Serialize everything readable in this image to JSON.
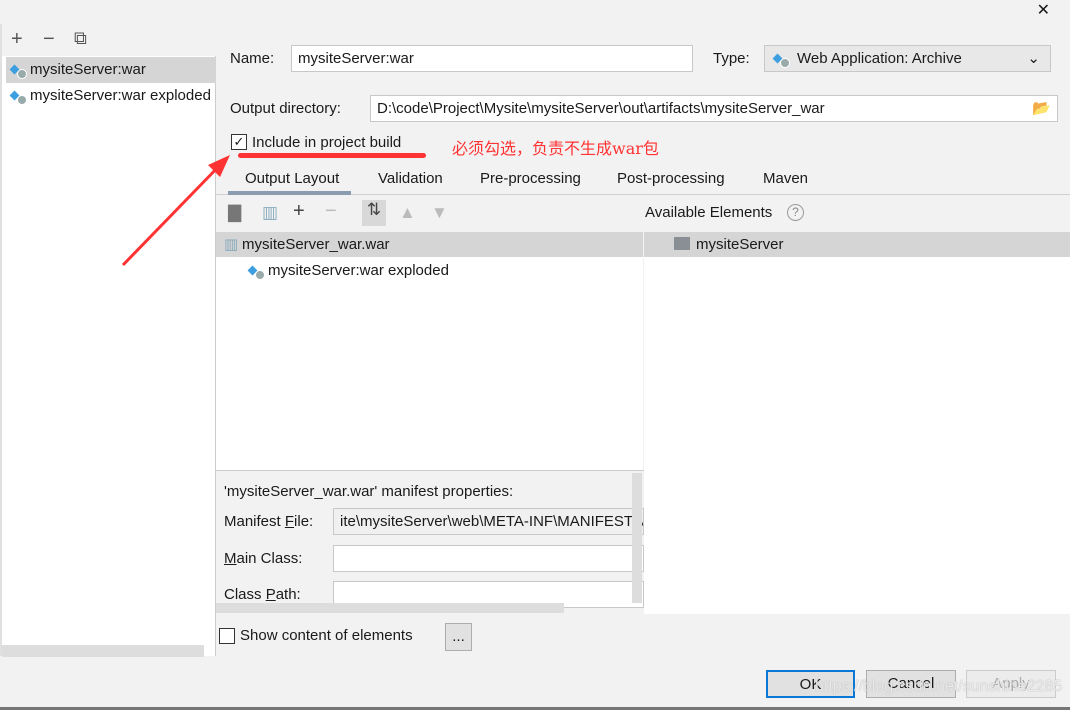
{
  "sidebar": {
    "toolbar": {
      "add": "+",
      "remove": "−",
      "copy": "⧉"
    },
    "items": [
      {
        "label": "mysiteServer:war",
        "selected": true
      },
      {
        "label": "mysiteServer:war exploded"
      }
    ]
  },
  "form": {
    "name_label": "Name:",
    "name_value": "mysiteServer:war",
    "type_label": "Type:",
    "type_value": "Web Application: Archive",
    "output_label": "Output directory:",
    "output_value": "D:\\code\\Project\\Mysite\\mysiteServer\\out\\artifacts\\mysiteServer_war",
    "include_label": "Include in project build",
    "include_checked": true
  },
  "annotation": {
    "text": "必须勾选，负责不生成war包",
    "color": "#ff3333"
  },
  "tabs": [
    "Output Layout",
    "Validation",
    "Pre-processing",
    "Post-processing",
    "Maven"
  ],
  "layout": {
    "tree": [
      {
        "label": "mysiteServer_war.war"
      },
      {
        "label": "mysiteServer:war exploded"
      }
    ],
    "available_title": "Available Elements",
    "available": [
      {
        "label": "mysiteServer"
      }
    ]
  },
  "manifest": {
    "title": "'mysiteServer_war.war' manifest properties:",
    "file_label": "Manifest File:",
    "file_value": "ite\\mysiteServer\\web\\META-INF\\MANIFEST.MF",
    "main_label": "Main Class:",
    "main_value": "",
    "path_label": "Class Path:",
    "path_value": ""
  },
  "show_content": {
    "label": "Show content of elements",
    "checked": false,
    "more": "..."
  },
  "buttons": {
    "ok": "OK",
    "cancel": "Cancel",
    "apply": "Apply"
  },
  "watermark": "https://blog.csdn.net/sunshine2285",
  "close": "✕"
}
